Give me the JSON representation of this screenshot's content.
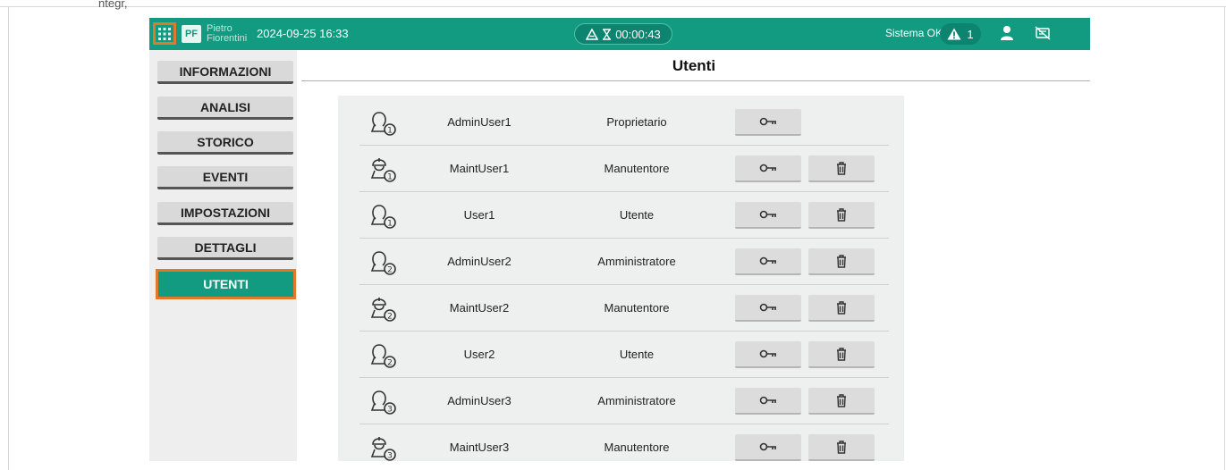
{
  "doc_fragment": "ntegr,",
  "header": {
    "brand_line1": "Pietro",
    "brand_line2": "Fiorentini",
    "datetime": "2024-09-25 16:33",
    "timer": "00:00:43",
    "system_status": "Sistema OK",
    "alarm_count": "1",
    "colors": {
      "bar": "#139b82",
      "pill": "#0d8470",
      "highlight": "#e07a2a"
    }
  },
  "nav": {
    "items": [
      "INFORMAZIONI",
      "ANALISI",
      "STORICO",
      "EVENTI",
      "IMPOSTAZIONI",
      "DETTAGLI",
      "UTENTI"
    ],
    "active": "UTENTI"
  },
  "page": {
    "title": "Utenti"
  },
  "users": [
    {
      "name": "AdminUser1",
      "role": "Proprietario",
      "level": "1",
      "icon": "admin-user-icon",
      "deletable": false
    },
    {
      "name": "MaintUser1",
      "role": "Manutentore",
      "level": "1",
      "icon": "maintenance-user-icon",
      "deletable": true
    },
    {
      "name": "User1",
      "role": "Utente",
      "level": "1",
      "icon": "standard-user-icon",
      "deletable": true
    },
    {
      "name": "AdminUser2",
      "role": "Amministratore",
      "level": "2",
      "icon": "admin-user-icon",
      "deletable": true
    },
    {
      "name": "MaintUser2",
      "role": "Manutentore",
      "level": "2",
      "icon": "maintenance-user-icon",
      "deletable": true
    },
    {
      "name": "User2",
      "role": "Utente",
      "level": "2",
      "icon": "standard-user-icon",
      "deletable": true
    },
    {
      "name": "AdminUser3",
      "role": "Amministratore",
      "level": "3",
      "icon": "admin-user-icon",
      "deletable": true
    },
    {
      "name": "MaintUser3",
      "role": "Manutentore",
      "level": "3",
      "icon": "maintenance-user-icon",
      "deletable": true
    }
  ]
}
